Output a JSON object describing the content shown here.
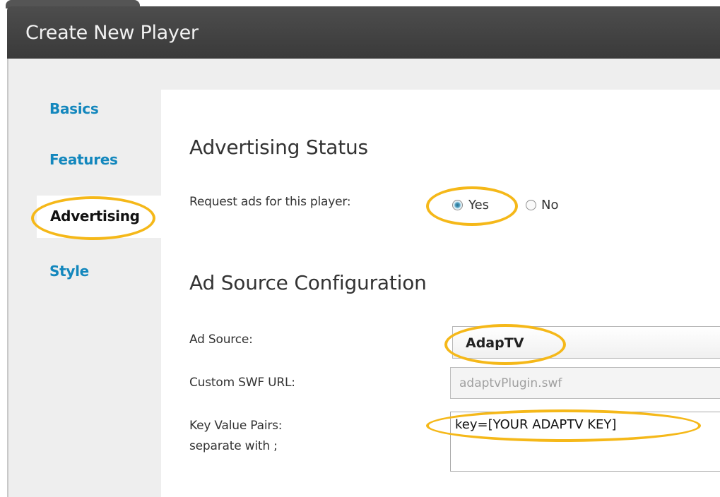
{
  "header": {
    "title": "Create New Player"
  },
  "sidebar": {
    "items": [
      {
        "label": "Basics"
      },
      {
        "label": "Features"
      },
      {
        "label": "Advertising",
        "active": true
      },
      {
        "label": "Style"
      }
    ]
  },
  "advertising_status": {
    "title": "Advertising Status",
    "request_label": "Request ads for this player:",
    "options": [
      {
        "label": "Yes",
        "checked": true
      },
      {
        "label": "No",
        "checked": false
      }
    ]
  },
  "ad_source_config": {
    "title": "Ad Source Configuration",
    "ad_source_label": "Ad Source:",
    "ad_source_value": "AdapTV",
    "custom_swf_label": "Custom SWF URL:",
    "custom_swf_value": "adaptvPlugin.swf",
    "kv_label_line1": "Key Value Pairs:",
    "kv_label_line2": "separate with ;",
    "kv_value": "key=[YOUR ADAPTV KEY]"
  },
  "colors": {
    "highlight": "#f5b819",
    "sidebar_link": "#1387bd",
    "header_bg": "#444444"
  }
}
